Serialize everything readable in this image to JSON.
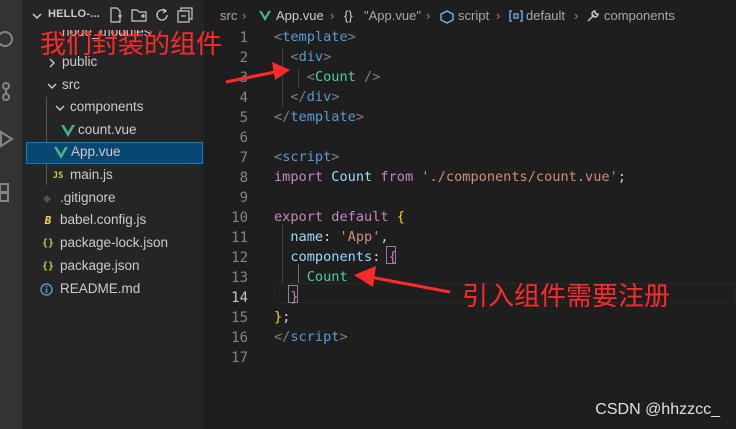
{
  "explorer": {
    "project_title": "HELLO-...",
    "items": [
      {
        "label": "node_modules"
      },
      {
        "label": "public"
      },
      {
        "label": "src"
      },
      {
        "label": "components"
      },
      {
        "label": "count.vue"
      },
      {
        "label": "App.vue"
      },
      {
        "label": "main.js"
      },
      {
        "label": ".gitignore"
      },
      {
        "label": "babel.config.js"
      },
      {
        "label": "package-lock.json"
      },
      {
        "label": "package.json"
      },
      {
        "label": "README.md"
      }
    ]
  },
  "breadcrumb": {
    "src": "src",
    "file": "App.vue",
    "braces": "{}",
    "module": "\"App.vue\"",
    "script": "script",
    "default": "default",
    "components": "components"
  },
  "editor": {
    "line_numbers": [
      "1",
      "2",
      "3",
      "4",
      "5",
      "6",
      "7",
      "8",
      "9",
      "10",
      "11",
      "12",
      "13",
      "14",
      "15",
      "16",
      "17"
    ],
    "active_line": "14",
    "lines": {
      "l1": {
        "open": "<",
        "tag": "template",
        "close": ">"
      },
      "l2": {
        "open": "<",
        "tag": "div",
        "close": ">"
      },
      "l3": {
        "open": "<",
        "tag": "Count",
        "close": " />"
      },
      "l4": {
        "open": "</",
        "tag": "div",
        "close": ">"
      },
      "l5": {
        "open": "</",
        "tag": "template",
        "close": ">"
      },
      "l7": {
        "open": "<",
        "tag": "script",
        "close": ">"
      },
      "l8": {
        "kw": "import",
        "name": "Count",
        "kw2": "from",
        "str": "'./components/count.vue'",
        "end": ";"
      },
      "l10": {
        "kw": "export",
        "kw2": "default",
        "brace": "{"
      },
      "l11": {
        "key": "name",
        "colon": ":",
        "str": "'App'",
        "comma": ","
      },
      "l12": {
        "key": "components",
        "colon": ":",
        "brace": "{"
      },
      "l13": {
        "name": "Count"
      },
      "l14": {
        "brace": "}"
      },
      "l15": {
        "brace": "}",
        "end": ";"
      },
      "l16": {
        "open": "</",
        "tag": "script",
        "close": ">"
      }
    }
  },
  "annotations": {
    "top": "我们封装的组件",
    "bottom": "引入组件需要注册",
    "watermark": "CSDN @hhzzcc_"
  },
  "colors": {
    "annotation_red": "#ff2a2a",
    "vue_green": "#41b883",
    "selection": "#094771"
  }
}
